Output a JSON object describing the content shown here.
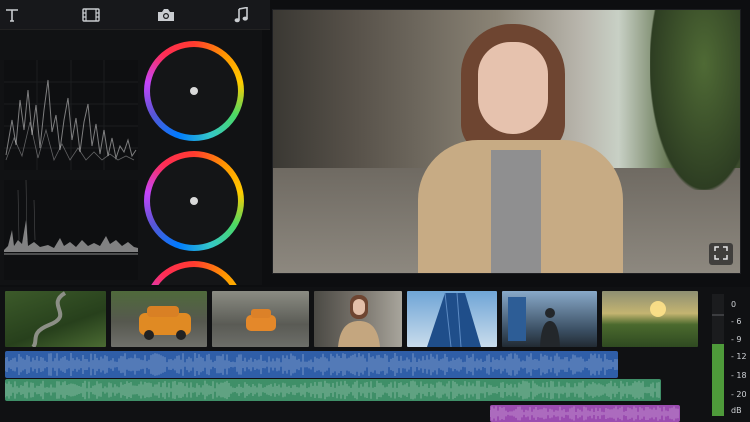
{
  "toolbar": {
    "icons": [
      "text-icon",
      "film-icon",
      "camera-icon",
      "music-note-icon"
    ]
  },
  "color_wheels": [
    "lift-wheel",
    "gamma-wheel",
    "gain-wheel"
  ],
  "timeline": {
    "clips": [
      "winding-road",
      "orange-car-front",
      "orange-car-road",
      "woman-portrait",
      "glass-tower",
      "man-city",
      "sunset-field"
    ],
    "audio_tracks": [
      {
        "name": "audio-track-1",
        "color": "#2f5ea8"
      },
      {
        "name": "audio-track-2",
        "color": "#3f8f68"
      },
      {
        "name": "audio-track-3",
        "color": "#9a4cb0"
      }
    ]
  },
  "meter": {
    "labels": [
      "0",
      "- 6",
      "- 9",
      "- 12",
      "- 18",
      "- 20",
      "dB"
    ],
    "level": 0.62
  },
  "colors": {
    "accent_audio_blue": "#2f5ea8",
    "accent_audio_green": "#3f8f68",
    "accent_audio_purple": "#9a4cb0",
    "meter_green": "#4e9a3a"
  }
}
